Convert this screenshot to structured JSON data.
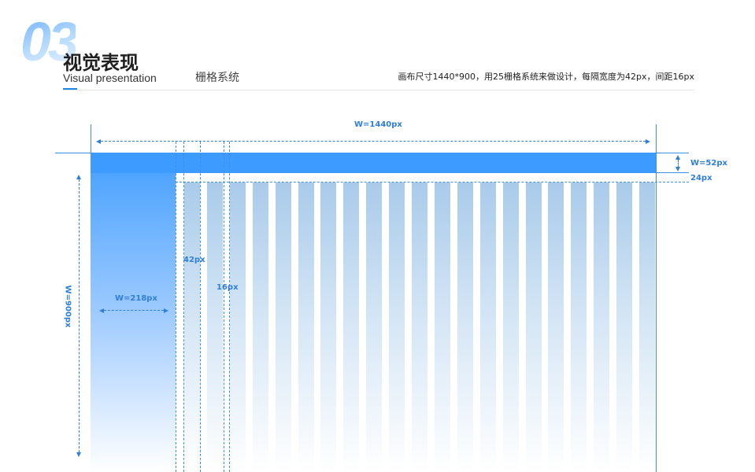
{
  "header": {
    "number": "03",
    "title_cn": "视觉表现",
    "title_en": "Visual presentation",
    "section": "栅格系统",
    "description": "画布尺寸1440*900，用25栅格系统来做设计，每隔宽度为42px，间距16px"
  },
  "diagram": {
    "canvas_width_label": "W=1440px",
    "canvas_height_label": "W=900px",
    "topbar_height_label": "W=52px",
    "top_gap_label": "24px",
    "sidebar_width_label": "W=218px",
    "column_width_label": "42px",
    "gutter_label": "16px",
    "column_count": 21
  },
  "colors": {
    "accent": "#3d9bff",
    "line": "#3d8ee6",
    "column": "#a9cbea",
    "label": "#2f7fd8"
  }
}
